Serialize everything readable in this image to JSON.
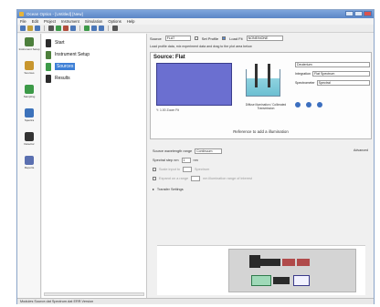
{
  "window": {
    "title": "Ocean Optics - [Untitled] [New]"
  },
  "menu": [
    "File",
    "Edit",
    "Project",
    "Instrument",
    "Simulation",
    "Options",
    "Help"
  ],
  "nav": [
    {
      "label": "Instrument Setup",
      "icon": "instrument-icon",
      "color": "#4d7f3c"
    },
    {
      "label": "Sources",
      "icon": "source-icon",
      "color": "#c8962e"
    },
    {
      "label": "Sampling",
      "icon": "sampling-icon",
      "color": "#3c9a48"
    },
    {
      "label": "Spectra",
      "icon": "spectrum-icon",
      "color": "#3c72bb"
    },
    {
      "label": "Detector",
      "icon": "detector-icon",
      "color": "#333333"
    },
    {
      "label": "Reports",
      "icon": "report-icon",
      "color": "#5a6fb0"
    }
  ],
  "tree": [
    {
      "label": "Start",
      "selected": false
    },
    {
      "label": "Instrument Setup",
      "selected": false
    },
    {
      "label": "Sources",
      "selected": true
    },
    {
      "label": "Results",
      "selected": false
    }
  ],
  "top": {
    "source_label": "Source",
    "source_value": "FLAT",
    "check1_label": "Set Profile",
    "check2_label": "Load Fit",
    "fit_value": "NONE/NONE",
    "sub_text": "Load profile data, mix experiment data and drag to the plot area below"
  },
  "source": {
    "title": "Source: Flat",
    "spec_controls": "Y: 1.00  Zoom  Fit",
    "vessel_caption": "Diffuse illumination / Collimated Transmission",
    "rc": [
      {
        "label": "",
        "value": "Deuterium"
      },
      {
        "label": "Integration",
        "value": "Flat Spectrum"
      },
      {
        "label": "Spectrometer",
        "value": "Spectral"
      }
    ],
    "banner": "Reference to add a illumination"
  },
  "settings": {
    "row1_label": "Source wavelength range",
    "row1_value": "Continuum",
    "row2_label": "Spectral step nm",
    "row2_value": "1",
    "row2_unit": "nm",
    "row3_label": "Scale input to",
    "row3_unit": "Spectrum",
    "row4_label": "Expand on a range",
    "row4_unit": "nm illumination range of interest",
    "row5_label": "Transfer Settings",
    "advanced_label": "Advanced"
  },
  "status": {
    "text": "Modules  Source.dat  Spectrum.dat  ERR.Version"
  },
  "colors": {
    "spectrum_fill": "#6b6fd0",
    "selected": "#3d7fd6"
  }
}
